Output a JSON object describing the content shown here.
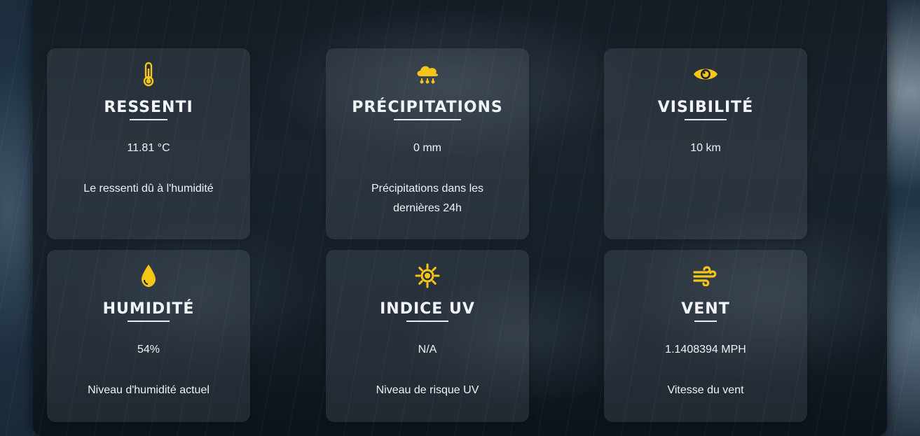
{
  "cards": [
    {
      "icon": "thermometer-icon",
      "title": "RESSENTI",
      "value": "11.81 °C",
      "description": "Le ressenti dû à l'humidité"
    },
    {
      "icon": "cloud-rain-icon",
      "title": "PRÉCIPITATIONS",
      "value": "0 mm",
      "description": "Précipitations dans les dernières 24h"
    },
    {
      "icon": "eye-icon",
      "title": "VISIBILITÉ",
      "value": "10 km",
      "description": ""
    },
    {
      "icon": "water-drop-icon",
      "title": "HUMIDITÉ",
      "value": "54%",
      "description": "Niveau d'humidité actuel"
    },
    {
      "icon": "sun-icon",
      "title": "INDICE UV",
      "value": "N/A",
      "description": "Niveau de risque UV"
    },
    {
      "icon": "wind-icon",
      "title": "VENT",
      "value": "1.1408394 MPH",
      "description": "Vitesse du vent"
    }
  ],
  "colors": {
    "accent": "#f5c518",
    "text": "#eef2f5"
  }
}
